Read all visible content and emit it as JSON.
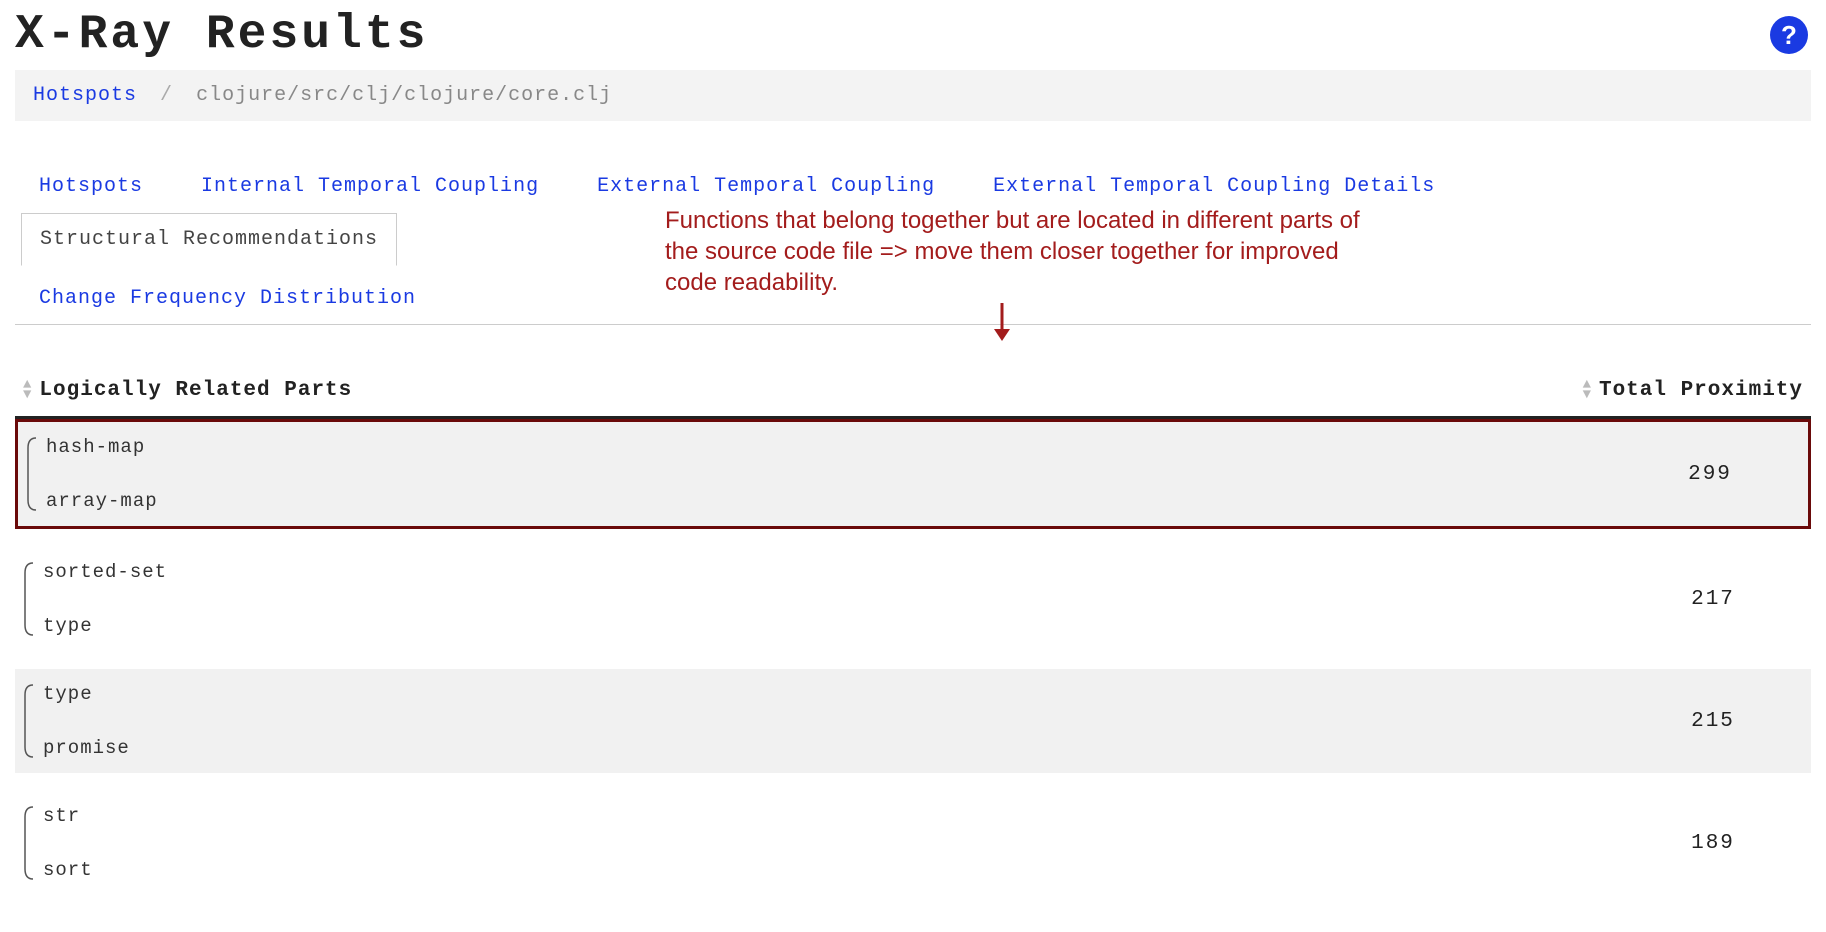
{
  "pageTitle": "X-Ray Results",
  "helpLabel": "?",
  "breadcrumb": {
    "root": "Hotspots",
    "current": "clojure/src/clj/clojure/core.clj"
  },
  "tabs": [
    {
      "id": "hotspots",
      "label": "Hotspots",
      "active": false
    },
    {
      "id": "internal-tc",
      "label": "Internal Temporal Coupling",
      "active": false
    },
    {
      "id": "external-tc",
      "label": "External Temporal Coupling",
      "active": false
    },
    {
      "id": "external-tc-details",
      "label": "External Temporal Coupling Details",
      "active": false
    },
    {
      "id": "structural-rec",
      "label": "Structural Recommendations",
      "active": true
    },
    {
      "id": "change-freq",
      "label": "Change Frequency Distribution",
      "active": false
    }
  ],
  "annotation": "Functions that belong together but are located in different parts of the source code file => move them closer together for improved code readability.",
  "columns": {
    "left": "Logically Related Parts",
    "right": "Total Proximity"
  },
  "rows": [
    {
      "fnA": "hash-map",
      "fnB": "array-map",
      "proximity": "299",
      "highlight": true
    },
    {
      "fnA": "sorted-set",
      "fnB": "type",
      "proximity": "217",
      "highlight": false
    },
    {
      "fnA": "type",
      "fnB": "promise",
      "proximity": "215",
      "highlight": false
    },
    {
      "fnA": "str",
      "fnB": "sort",
      "proximity": "189",
      "highlight": false
    }
  ]
}
